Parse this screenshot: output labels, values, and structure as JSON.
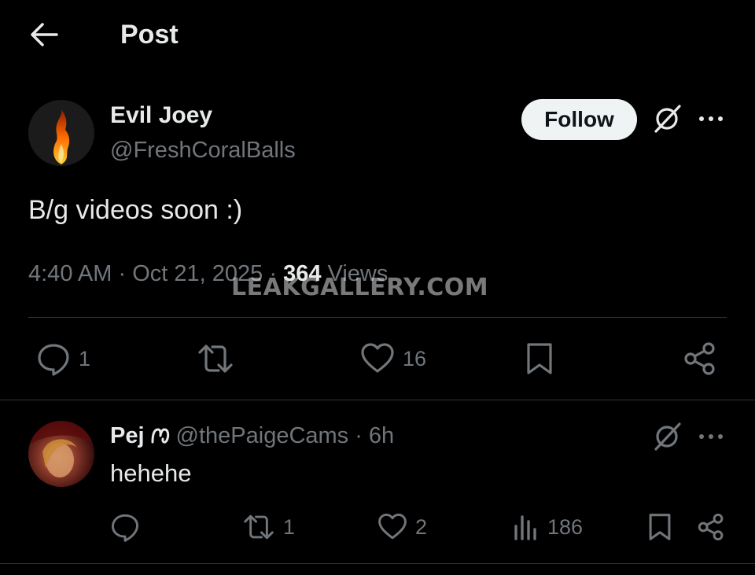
{
  "header": {
    "title": "Post",
    "back_icon": "arrow-left-icon"
  },
  "post": {
    "author": {
      "name": "Evil Joey",
      "handle": "@FreshCoralBalls",
      "avatar": "flame-avatar"
    },
    "follow_label": "Follow",
    "text": "B/g videos soon :)",
    "time": "4:40 AM",
    "date": "Oct 21, 2025",
    "separator": "·",
    "views_count": "364",
    "views_label": "Views",
    "actions": {
      "replies": "1",
      "reposts": "",
      "likes": "16"
    }
  },
  "watermark": "LEAKGALLERY.COM",
  "reply": {
    "name": "Pej",
    "handle": "@thePaigeCams",
    "separator": "·",
    "time": "6h",
    "text": "hehehe",
    "actions": {
      "replies": "",
      "reposts": "1",
      "likes": "2",
      "views": "186"
    }
  },
  "colors": {
    "background": "#000000",
    "text_primary": "#e7e9ea",
    "text_secondary": "#71767b",
    "divider": "#2f3336",
    "follow_bg": "#eff3f4"
  }
}
